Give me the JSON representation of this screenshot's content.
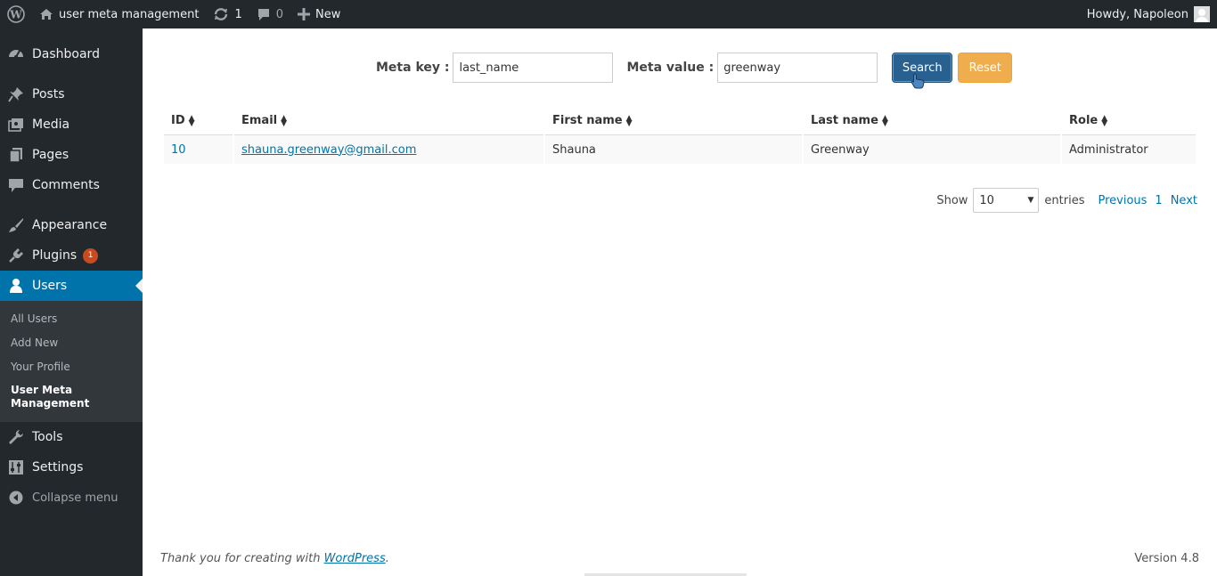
{
  "adminbar": {
    "site_name": "user meta management",
    "updates_count": "1",
    "comments_count": "0",
    "new_label": "New",
    "greeting": "Howdy, Napoleon"
  },
  "sidebar": {
    "items": [
      {
        "label": "Dashboard",
        "icon": "dashboard-icon"
      },
      {
        "label": "Posts",
        "icon": "pin-icon"
      },
      {
        "label": "Media",
        "icon": "media-icon"
      },
      {
        "label": "Pages",
        "icon": "pages-icon"
      },
      {
        "label": "Comments",
        "icon": "comment-icon"
      },
      {
        "label": "Appearance",
        "icon": "brush-icon"
      },
      {
        "label": "Plugins",
        "icon": "plug-icon",
        "badge": "1"
      },
      {
        "label": "Users",
        "icon": "user-icon"
      },
      {
        "label": "Tools",
        "icon": "wrench-icon"
      },
      {
        "label": "Settings",
        "icon": "settings-icon"
      }
    ],
    "users_submenu": [
      "All Users",
      "Add New",
      "Your Profile",
      "User Meta Management"
    ],
    "collapse_label": "Collapse menu"
  },
  "search": {
    "meta_key_label": "Meta key :",
    "meta_key_value": "last_name",
    "meta_value_label": "Meta value :",
    "meta_value_value": "greenway",
    "search_label": "Search",
    "reset_label": "Reset"
  },
  "table": {
    "columns": [
      "ID",
      "Email",
      "First name",
      "Last name",
      "Role"
    ],
    "rows": [
      {
        "id": "10",
        "email": "shauna.greenway@gmail.com",
        "first_name": "Shauna",
        "last_name": "Greenway",
        "role": "Administrator"
      }
    ]
  },
  "pager": {
    "show_label": "Show",
    "entries_value": "10",
    "entries_label": "entries",
    "previous_label": "Previous",
    "page": "1",
    "next_label": "Next"
  },
  "footer": {
    "thanks_prefix": "Thank you for creating with ",
    "thanks_link": "WordPress",
    "thanks_suffix": ".",
    "version": "Version 4.8"
  },
  "colors": {
    "adminbar_bg": "#23282d",
    "active_menu": "#0073aa",
    "primary_button": "#286090",
    "warning_button": "#f0ad4e",
    "link": "#0073aa"
  }
}
